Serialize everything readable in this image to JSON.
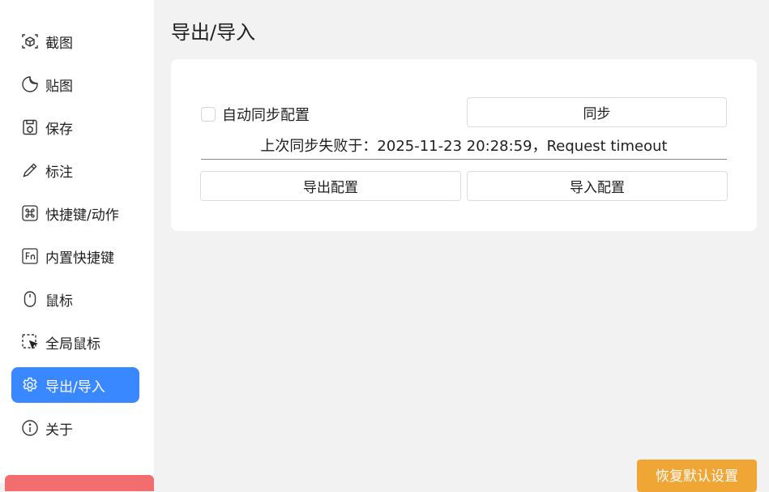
{
  "sidebar": {
    "items": [
      {
        "label": "截图",
        "icon": "screenshot-icon"
      },
      {
        "label": "贴图",
        "icon": "sticker-icon"
      },
      {
        "label": "保存",
        "icon": "save-icon"
      },
      {
        "label": "标注",
        "icon": "pencil-icon"
      },
      {
        "label": "快捷键/动作",
        "icon": "command-key-icon"
      },
      {
        "label": "内置快捷键",
        "icon": "fn-key-icon"
      },
      {
        "label": "鼠标",
        "icon": "mouse-icon"
      },
      {
        "label": "全局鼠标",
        "icon": "selection-cursor-icon"
      },
      {
        "label": "导出/导入",
        "icon": "gear-icon",
        "active": true
      },
      {
        "label": "关于",
        "icon": "info-icon"
      }
    ]
  },
  "main": {
    "title": "导出/导入",
    "auto_sync_label": "自动同步配置",
    "auto_sync_checked": false,
    "sync_button": "同步",
    "status": "上次同步失败于：2025-11-23 20:28:59，Request timeout",
    "export_button": "导出配置",
    "import_button": "导入配置",
    "reset_button": "恢复默认设置"
  },
  "colors": {
    "accent": "#3a88ff",
    "reset": "#f0a634",
    "danger": "#f26d6d",
    "background": "#f2f2f2"
  }
}
